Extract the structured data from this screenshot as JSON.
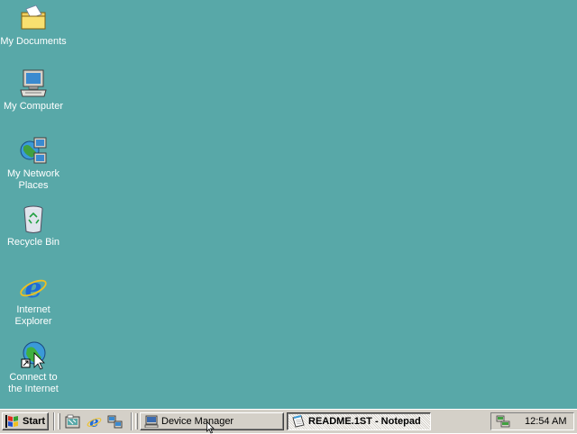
{
  "desktop": {
    "background_color": "#58a8a8",
    "icons": [
      {
        "label": "My Documents",
        "icon": "folder-icon"
      },
      {
        "label": "My Computer",
        "icon": "computer-icon"
      },
      {
        "label": "My Network\nPlaces",
        "icon": "network-places-icon"
      },
      {
        "label": "Recycle Bin",
        "icon": "recycle-bin-icon"
      },
      {
        "label": "Internet\nExplorer",
        "icon": "internet-explorer-icon"
      },
      {
        "label": "Connect to\nthe Internet",
        "icon": "connect-internet-icon"
      }
    ]
  },
  "taskbar": {
    "start_label": "Start",
    "quick_launch": [
      "show-desktop-icon",
      "internet-explorer-icon",
      "network-icon"
    ],
    "tasks": [
      {
        "label": "Device Manager",
        "icon": "device-manager-icon",
        "active": false
      },
      {
        "label": "README.1ST - Notepad",
        "icon": "notepad-icon",
        "active": true
      }
    ],
    "tray": {
      "icons": [
        "network-status-icon"
      ],
      "clock": "12:54 AM"
    }
  }
}
